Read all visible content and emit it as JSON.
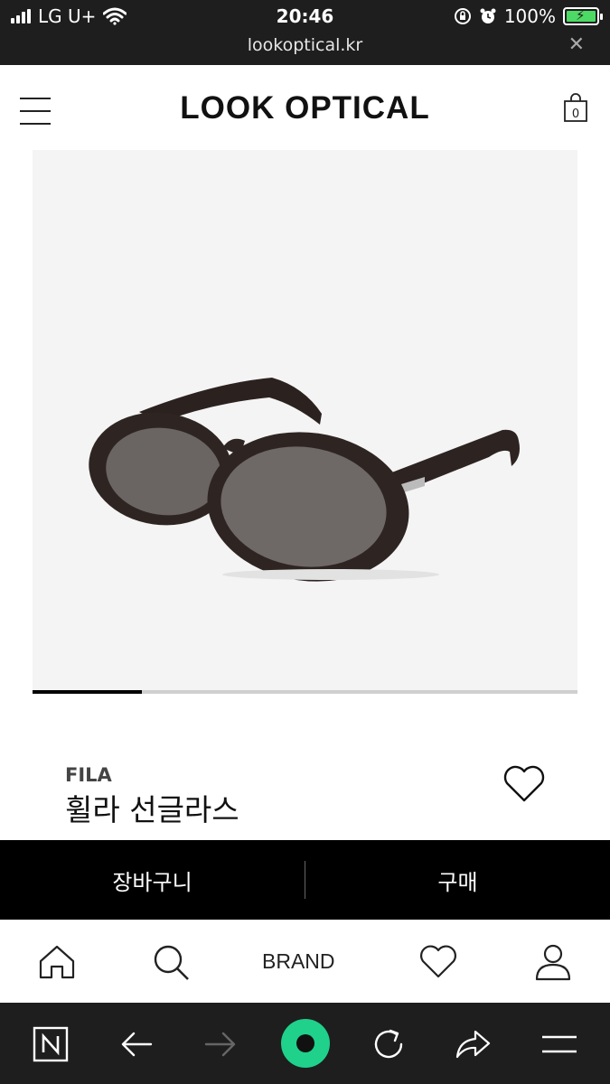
{
  "status_bar": {
    "carrier": "LG U+",
    "time": "20:46",
    "battery": "100%",
    "url": "lookoptical.kr",
    "close_icon": "close-icon"
  },
  "header": {
    "logo": "LOOK OPTICAL",
    "cart_count": "0"
  },
  "product": {
    "image_alt": "sunglasses",
    "image_progress": 0.2,
    "brand": "FILA",
    "name": "휠라 선글라스"
  },
  "actions": {
    "cart_label": "장바구니",
    "buy_label": "구매"
  },
  "bottom_nav": {
    "items": [
      {
        "icon": "home-icon"
      },
      {
        "icon": "search-icon"
      },
      {
        "label": "BRAND"
      },
      {
        "icon": "heart-icon"
      },
      {
        "icon": "user-icon"
      }
    ]
  },
  "browser_toolbar": {
    "items": [
      "naver-icon",
      "back-icon",
      "forward-icon",
      "green-dot-icon",
      "refresh-icon",
      "share-icon",
      "menu-icon"
    ],
    "accent": "#1fd18a"
  }
}
